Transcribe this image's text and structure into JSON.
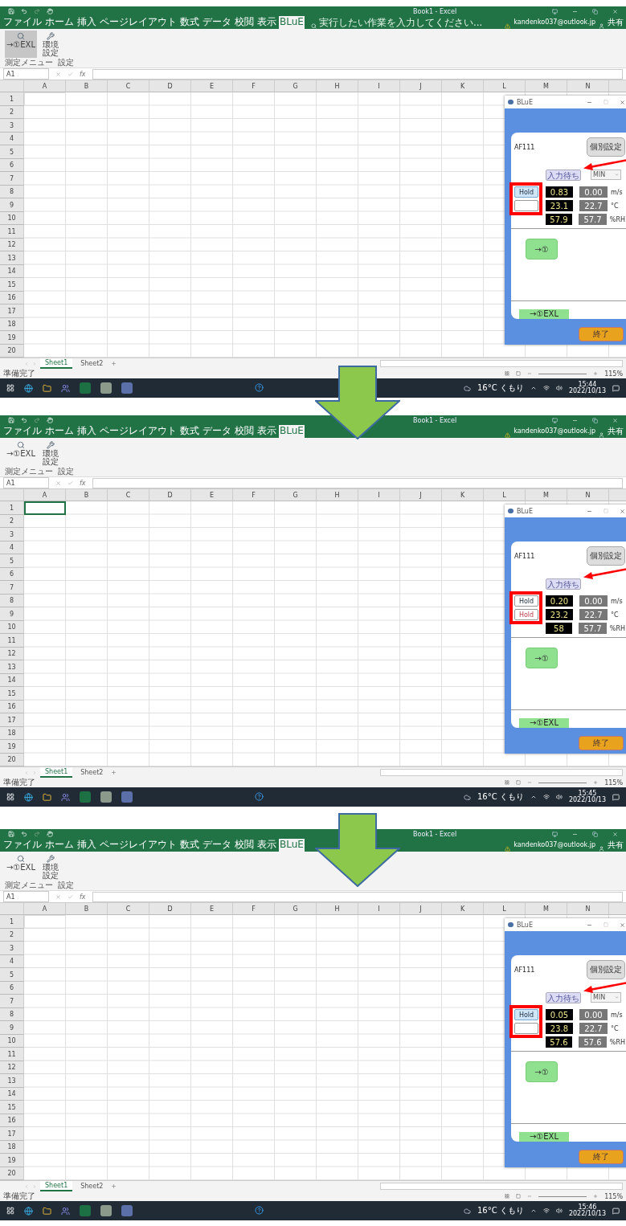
{
  "shots": [
    {
      "window_title": "Book1 - Excel",
      "tabs": [
        {
          "label": "ファイル",
          "selected": false
        },
        {
          "label": "ホーム",
          "selected": false
        },
        {
          "label": "挿入",
          "selected": false
        },
        {
          "label": "ページレイアウト",
          "selected": false
        },
        {
          "label": "数式",
          "selected": false
        },
        {
          "label": "データ",
          "selected": false
        },
        {
          "label": "校閲",
          "selected": false
        },
        {
          "label": "表示",
          "selected": false
        },
        {
          "label": "BLuE",
          "selected": true
        }
      ],
      "search_hint": "実行したい作業を入力してください...",
      "account": "kandenko037@outlook.jp",
      "share": "共有",
      "ribbon_buttons": [
        {
          "label": "→①EXL",
          "selected": true
        },
        {
          "label": "環境設定",
          "selected": false
        }
      ],
      "ribbon_groups": [
        "測定メニュー",
        "設定"
      ],
      "name_box": "A1",
      "function_label": "fx",
      "columns": [
        "A",
        "B",
        "C",
        "D",
        "E",
        "F",
        "G",
        "H",
        "I",
        "J",
        "K",
        "L",
        "M",
        "N"
      ],
      "rows": [
        "1",
        "2",
        "3",
        "4",
        "5",
        "6",
        "7",
        "8",
        "9",
        "10",
        "11",
        "12",
        "13",
        "14",
        "15",
        "16",
        "17",
        "18",
        "19",
        "20"
      ],
      "active_cell_outlined": false,
      "sheets": [
        {
          "label": "Sheet1",
          "selected": true
        },
        {
          "label": "Sheet2",
          "selected": false
        }
      ],
      "status": "準備完了",
      "zoom": "115%",
      "weather": "16°C くもり",
      "time": "15:44",
      "date": "2022/10/13",
      "panel": {
        "title": "BLuE",
        "device": "AF111",
        "settings_button": "個別設定",
        "reset_button": "入力待ち",
        "mode": "MIN",
        "holds": [
          {
            "label": "Hold",
            "on": true,
            "kind": "plain"
          },
          {
            "on": false,
            "kind": "plain"
          }
        ],
        "readings": [
          {
            "live": "0.83",
            "min": "0.00",
            "unit": "m/s"
          },
          {
            "live": "23.1",
            "min": "22.7",
            "unit": "°C"
          },
          {
            "live": "57.9",
            "min": "57.7",
            "unit": "%RH"
          }
        ],
        "send_button": "→①",
        "excel_button": "→①EXL",
        "close_button": "終了"
      }
    },
    {
      "window_title": "Book1 - Excel",
      "tabs": [
        {
          "label": "ファイル",
          "selected": false
        },
        {
          "label": "ホーム",
          "selected": false
        },
        {
          "label": "挿入",
          "selected": false
        },
        {
          "label": "ページレイアウト",
          "selected": false
        },
        {
          "label": "数式",
          "selected": false
        },
        {
          "label": "データ",
          "selected": false
        },
        {
          "label": "校閲",
          "selected": false
        },
        {
          "label": "表示",
          "selected": false
        },
        {
          "label": "BLuE",
          "selected": true
        }
      ],
      "account": "kandenko037@outlook.jp",
      "share": "共有",
      "ribbon_buttons": [
        {
          "label": "→①EXL",
          "selected": false
        },
        {
          "label": "環境設定",
          "selected": false
        }
      ],
      "ribbon_groups": [
        "測定メニュー",
        "設定"
      ],
      "name_box": "A1",
      "function_label": "fx",
      "columns": [
        "A",
        "B",
        "C",
        "D",
        "E",
        "F",
        "G",
        "H",
        "I",
        "J",
        "K",
        "L",
        "M",
        "N"
      ],
      "rows": [
        "1",
        "2",
        "3",
        "4",
        "5",
        "6",
        "7",
        "8",
        "9",
        "10",
        "11",
        "12",
        "13",
        "14",
        "15",
        "16",
        "17",
        "18",
        "19",
        "20"
      ],
      "active_cell_outlined": true,
      "sheets": [
        {
          "label": "Sheet1",
          "selected": true
        },
        {
          "label": "Sheet2",
          "selected": false
        }
      ],
      "status": "準備完了",
      "zoom": "115%",
      "weather": "16°C くもり",
      "time": "15:45",
      "date": "2022/10/13",
      "panel": {
        "title": "BLuE",
        "device": "AF111",
        "settings_button": "個別設定",
        "reset_button": "入力待ち",
        "holds": [
          {
            "label": "Hold",
            "on": false,
            "kind": "plain"
          },
          {
            "label": "Hold",
            "on": false,
            "kind": "red"
          }
        ],
        "readings": [
          {
            "live": "0.20",
            "min": "0.00",
            "unit": "m/s"
          },
          {
            "live": "23.2",
            "min": "22.7",
            "unit": "°C"
          },
          {
            "live": "58",
            "min": "57.7",
            "unit": "%RH"
          }
        ],
        "send_button": "→①",
        "excel_button": "→①EXL",
        "close_button": "終了"
      }
    },
    {
      "window_title": "Book1 - Excel",
      "tabs": [
        {
          "label": "ファイル",
          "selected": false
        },
        {
          "label": "ホーム",
          "selected": false
        },
        {
          "label": "挿入",
          "selected": false
        },
        {
          "label": "ページレイアウト",
          "selected": false
        },
        {
          "label": "数式",
          "selected": false
        },
        {
          "label": "データ",
          "selected": false
        },
        {
          "label": "校閲",
          "selected": false
        },
        {
          "label": "表示",
          "selected": false
        },
        {
          "label": "BLuE",
          "selected": true
        }
      ],
      "account": "kandenko037@outlook.jp",
      "share": "共有",
      "ribbon_buttons": [
        {
          "label": "→①EXL",
          "selected": false
        },
        {
          "label": "環境設定",
          "selected": false
        }
      ],
      "ribbon_groups": [
        "測定メニュー",
        "設定"
      ],
      "name_box": "A1",
      "function_label": "fx",
      "columns": [
        "A",
        "B",
        "C",
        "D",
        "E",
        "F",
        "G",
        "H",
        "I",
        "J",
        "K",
        "L",
        "M",
        "N"
      ],
      "rows": [
        "1",
        "2",
        "3",
        "4",
        "5",
        "6",
        "7",
        "8",
        "9",
        "10",
        "11",
        "12",
        "13",
        "14",
        "15",
        "16",
        "17",
        "18",
        "19",
        "20"
      ],
      "active_cell_outlined": false,
      "sheets": [
        {
          "label": "Sheet1",
          "selected": true
        },
        {
          "label": "Sheet2",
          "selected": false
        }
      ],
      "status": "準備完了",
      "zoom": "115%",
      "weather": "16°C くもり",
      "time": "15:46",
      "date": "2022/10/13",
      "panel": {
        "title": "BLuE",
        "device": "AF111",
        "settings_button": "個別設定",
        "reset_button": "入力待ち",
        "mode": "MIN",
        "holds": [
          {
            "label": "Hold",
            "on": true,
            "kind": "plain"
          },
          {
            "on": false,
            "kind": "plain"
          }
        ],
        "readings": [
          {
            "live": "0.05",
            "min": "0.00",
            "unit": "m/s"
          },
          {
            "live": "23.8",
            "min": "22.7",
            "unit": "°C"
          },
          {
            "live": "57.6",
            "min": "57.6",
            "unit": "%RH"
          }
        ],
        "send_button": "→①",
        "excel_button": "→①EXL",
        "close_button": "終了"
      }
    }
  ]
}
